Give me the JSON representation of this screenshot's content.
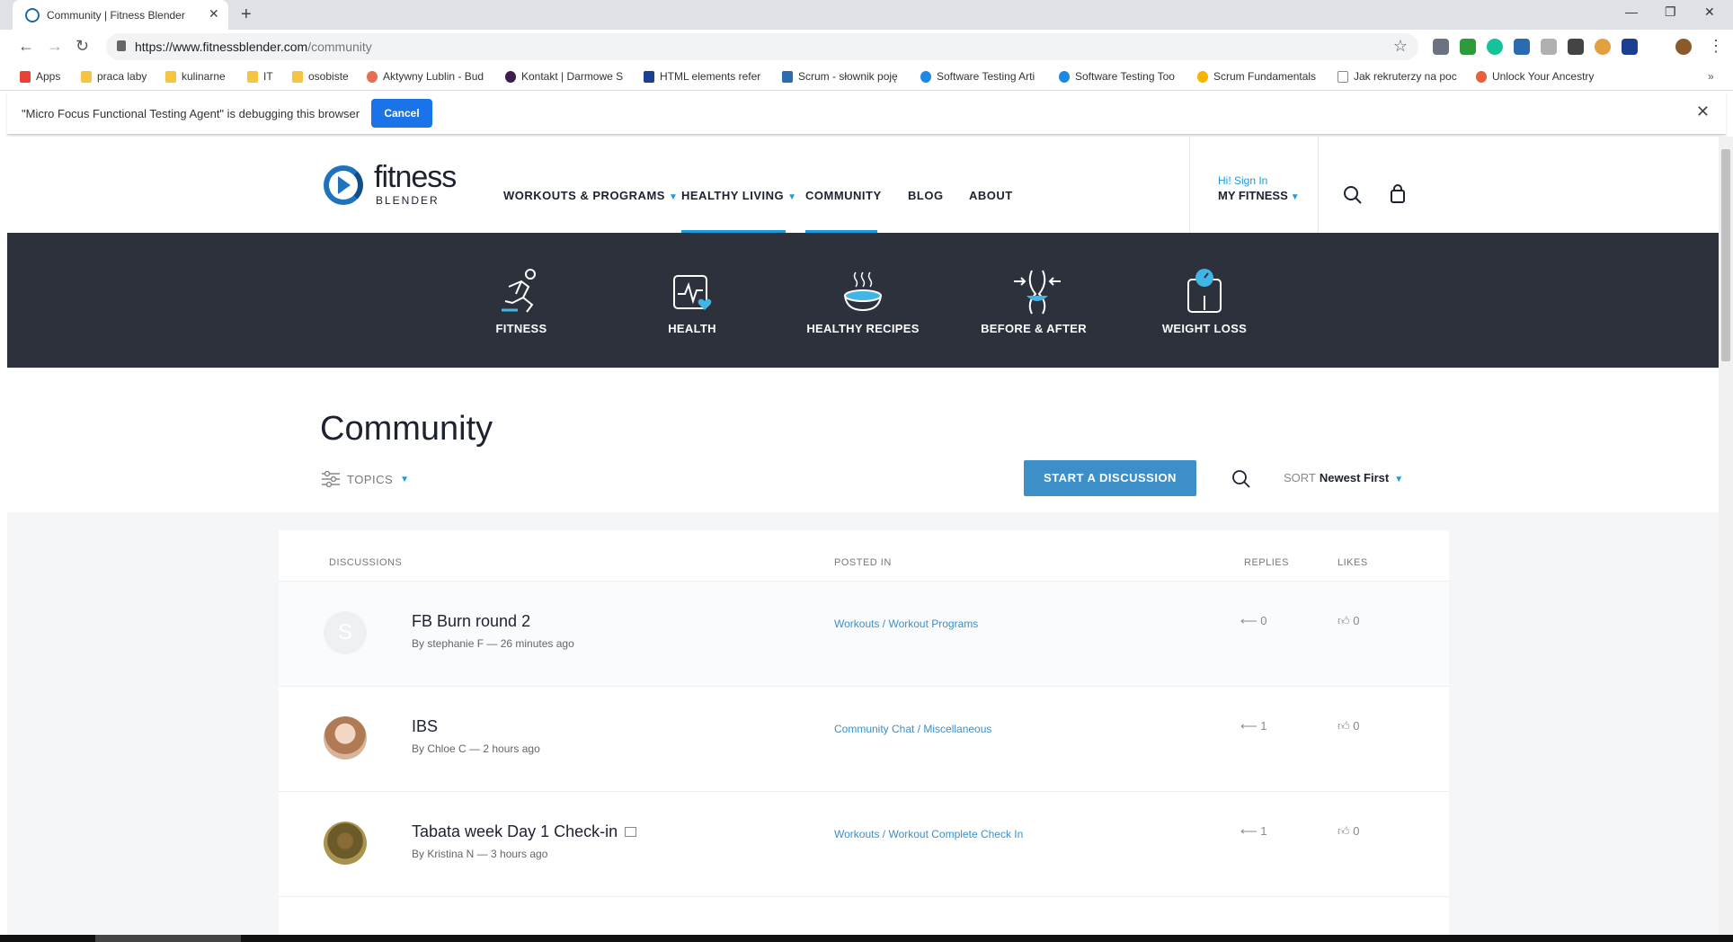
{
  "browser": {
    "tab_title": "Community | Fitness Blender",
    "url_host": "https://www.fitnessblender.com",
    "url_path": "/community",
    "bookmarks": [
      "Apps",
      "praca laby",
      "kulinarne",
      "IT",
      "osobiste",
      "Aktywny Lublin - Bud",
      "Kontakt | Darmowe S",
      "HTML elements refer",
      "Scrum - słownik poję",
      "Software Testing Arti",
      "Software Testing Too",
      "Scrum Fundamentals",
      "Jak rekruterzy na poc",
      "Unlock Your Ancestry"
    ],
    "debug_message": "\"Micro Focus Functional Testing Agent\" is debugging this browser",
    "debug_cancel": "Cancel"
  },
  "site": {
    "logo_word": "fitness",
    "logo_sub": "BLENDER",
    "nav": [
      "WORKOUTS & PROGRAMS",
      "HEALTHY LIVING",
      "COMMUNITY",
      "BLOG",
      "ABOUT"
    ],
    "signin": "Hi! Sign In",
    "my_fitness": "MY FITNESS",
    "categories": [
      "FITNESS",
      "HEALTH",
      "HEALTHY RECIPES",
      "BEFORE & AFTER",
      "WEIGHT LOSS"
    ]
  },
  "community": {
    "title": "Community",
    "topics_label": "TOPICS",
    "start_button": "START A DISCUSSION",
    "sort_label": "SORT",
    "sort_value": "Newest First",
    "columns": [
      "DISCUSSIONS",
      "POSTED IN",
      "REPLIES",
      "LIKES"
    ],
    "rows": [
      {
        "title": "FB Burn round 2",
        "meta": "By stephanie F — 26 minutes ago",
        "category": "Workouts / Workout Programs",
        "replies": "0",
        "likes": "0",
        "avatar_letter": "S"
      },
      {
        "title": "IBS",
        "meta": "By Chloe C — 2 hours ago",
        "category": "Community Chat / Miscellaneous",
        "replies": "1",
        "likes": "0",
        "avatar_letter": ""
      },
      {
        "title": "Tabata week Day 1 Check-in",
        "meta": "By Kristina N — 3 hours ago",
        "category": "Workouts / Workout Complete Check In",
        "replies": "1",
        "likes": "0",
        "avatar_letter": ""
      }
    ]
  }
}
